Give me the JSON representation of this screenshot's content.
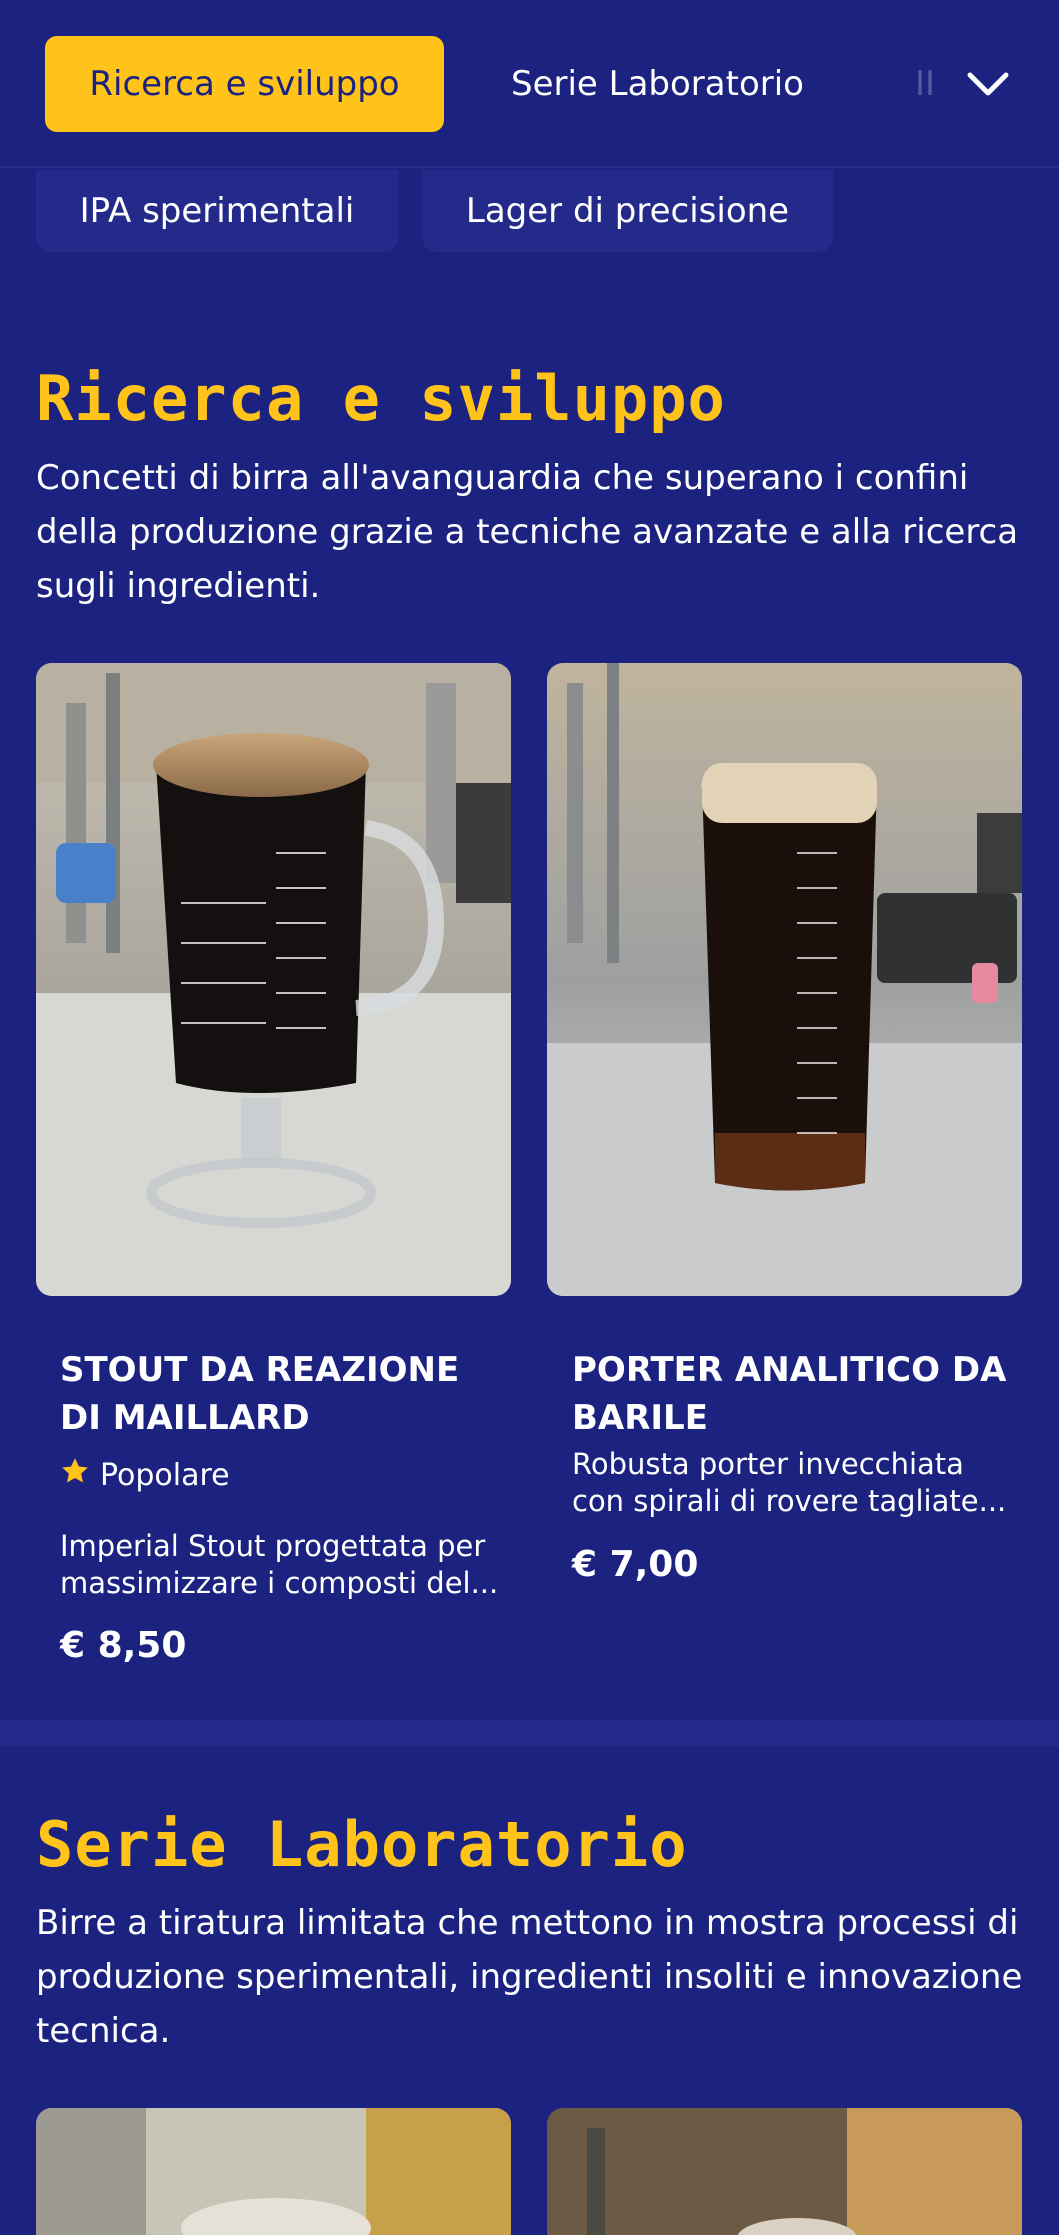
{
  "nav": {
    "active_category": "Ricerca e sviluppo",
    "category_2": "Serie Laboratorio",
    "category_3_partial": "II"
  },
  "chips": [
    "IPA sperimentali",
    "Lager di precisione"
  ],
  "sections": [
    {
      "title": "Ricerca e sviluppo",
      "description": "Concetti di birra all'avanguardia che superano i confini della produzione grazie a tecniche avanzate e alla ricerca sugli ingredienti.",
      "products": [
        {
          "name": "STOUT DA REAZIONE DI MAILLARD",
          "badge": "Popolare",
          "description": "Imperial Stout progettata per massimizzare i composti del...",
          "price": "€ 8,50"
        },
        {
          "name": "PORTER ANALITICO DA BARILE",
          "description": "Robusta porter invecchiata con spirali di rovere tagliate...",
          "price": "€ 7,00"
        }
      ]
    },
    {
      "title": "Serie Laboratorio",
      "description": "Birre a tiratura limitata che mettono in mostra processi di produzione sperimentali, ingredienti insoliti e innovazione tecnica."
    }
  ],
  "colors": {
    "background": "#1b2280",
    "accent": "#ffc31a",
    "surface": "#232a8a"
  },
  "icons": {
    "expand": "chevron-down-icon",
    "badge": "star-icon"
  }
}
